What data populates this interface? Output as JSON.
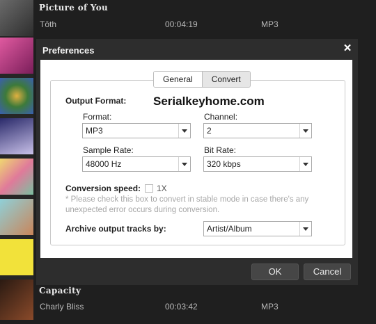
{
  "tracks": [
    {
      "title": "Picture of You",
      "artist": "Tôth",
      "duration": "00:04:19",
      "format": "MP3"
    },
    {
      "title": "Capacity",
      "artist": "Charly Bliss",
      "duration": "00:03:42",
      "format": "MP3"
    }
  ],
  "thumbnails": [
    "#4a4a4a",
    "#c43a8a",
    "#4b7bc2",
    "#7b6fb0",
    "#d9c46a",
    "#5da9b7",
    "#f2e23a",
    "#6b3e2a"
  ],
  "dialog": {
    "title": "Preferences",
    "close_icon": "×",
    "tabs": {
      "general": "General",
      "convert": "Convert"
    },
    "output_format_label": "Output Format:",
    "watermark": "Serialkeyhome.com",
    "format": {
      "label": "Format:",
      "value": "MP3"
    },
    "channel": {
      "label": "Channel:",
      "value": "2"
    },
    "sample_rate": {
      "label": "Sample Rate:",
      "value": "48000 Hz"
    },
    "bit_rate": {
      "label": "Bit Rate:",
      "value": "320 kbps"
    },
    "conversion_speed": {
      "label": "Conversion speed:",
      "option": "1X",
      "checked": false
    },
    "note_line1": "* Please check this box to convert in stable mode in case there's any",
    "note_line2": "unexpected error occurs during conversion.",
    "archive": {
      "label": "Archive output tracks by:",
      "value": "Artist/Album"
    },
    "ok_label": "OK",
    "cancel_label": "Cancel"
  }
}
